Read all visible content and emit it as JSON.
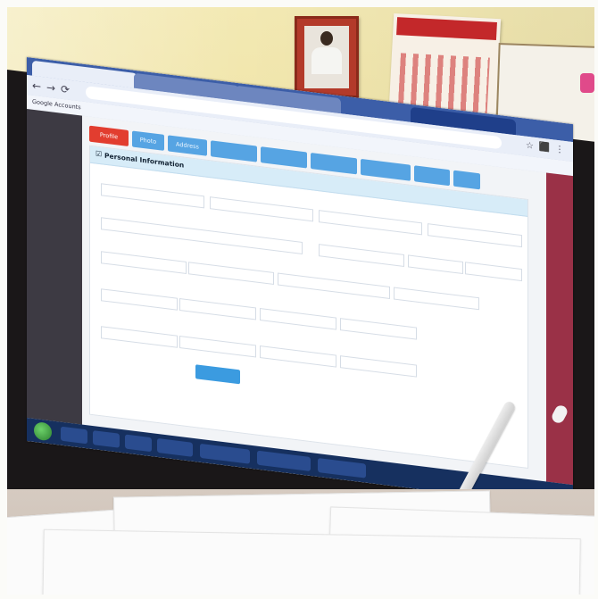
{
  "browser": {
    "tabs": [
      "",
      "",
      "",
      ""
    ],
    "address_bar": "",
    "bookmarks": [
      "Google Accounts",
      "",
      "",
      "",
      "",
      "",
      ""
    ]
  },
  "app": {
    "sidebar": [
      "",
      "",
      "",
      "",
      "",
      "",
      "",
      "",
      "",
      "",
      "",
      "",
      ""
    ],
    "main_tabs": [
      "Profile",
      "Photo",
      "Address",
      "",
      "",
      "",
      "",
      "",
      ""
    ],
    "section_title": "Personal Information",
    "fields": {
      "labels": [
        "",
        "",
        "",
        "",
        "",
        "",
        "",
        "",
        "",
        "",
        "",
        "",
        "",
        "",
        "",
        "",
        "",
        "",
        "",
        ""
      ],
      "values": [
        "",
        "",
        "",
        "",
        "",
        "",
        "",
        "",
        "",
        "",
        "",
        "",
        "",
        "",
        "",
        "",
        "",
        "",
        "",
        ""
      ]
    },
    "buttons": {
      "save": ""
    }
  },
  "taskbar": {
    "clock": ""
  }
}
